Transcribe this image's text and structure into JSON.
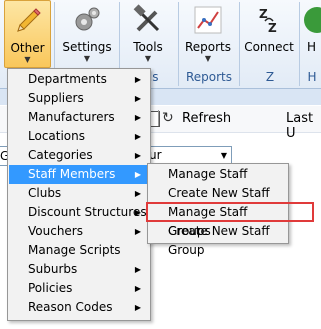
{
  "ribbon": {
    "buttons": [
      {
        "label": "Other",
        "icon": "pencil-icon"
      },
      {
        "label": "Settings",
        "icon": "gears-icon"
      },
      {
        "label": "Tools",
        "icon": "tools-icon"
      },
      {
        "label": "Reports",
        "icon": "chart-icon"
      },
      {
        "label": "Connect",
        "icon": "zz-icon"
      },
      {
        "label": "H",
        "icon": "help-icon"
      }
    ],
    "groups": [
      "ols",
      "Reports",
      "Z Connect",
      "H"
    ]
  },
  "toolbar": {
    "refresh_label": "Refresh",
    "last_label": "Last U"
  },
  "filters": {
    "left_value": "G",
    "right_value": "ur"
  },
  "menu": {
    "items": [
      {
        "label": "Departments",
        "submenu": true
      },
      {
        "label": "Suppliers",
        "submenu": true
      },
      {
        "label": "Manufacturers",
        "submenu": true
      },
      {
        "label": "Locations",
        "submenu": true
      },
      {
        "label": "Categories",
        "submenu": true
      },
      {
        "label": "Staff Members",
        "submenu": true,
        "highlighted": true
      },
      {
        "label": "Clubs",
        "submenu": true
      },
      {
        "label": "Discount Structures",
        "submenu": true
      },
      {
        "label": "Vouchers",
        "submenu": true
      },
      {
        "label": "Manage Scripts",
        "submenu": false
      },
      {
        "label": "Suburbs",
        "submenu": true
      },
      {
        "label": "Policies",
        "submenu": true
      },
      {
        "label": "Reason Codes",
        "submenu": true
      }
    ],
    "submenu_arrow": "▶"
  },
  "submenu": {
    "items": [
      {
        "label": "Manage Staff"
      },
      {
        "label": "Create New Staff"
      },
      {
        "label": "Manage Staff Groups",
        "annotated": true
      },
      {
        "label": "Create New Staff Group"
      }
    ]
  },
  "colors": {
    "highlight": "#3399ff",
    "annotation": "#e03a3a",
    "ribbon_group_label": "#2e5a94"
  }
}
